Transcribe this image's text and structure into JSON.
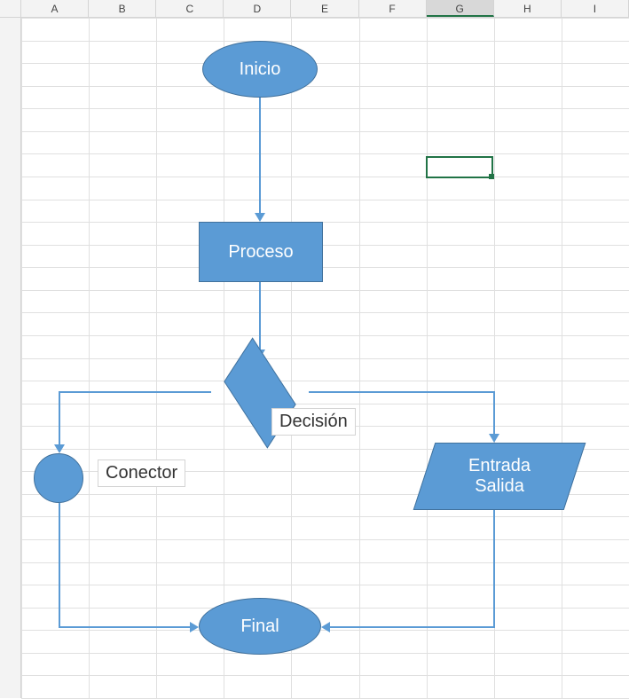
{
  "spreadsheet": {
    "columns": [
      "A",
      "B",
      "C",
      "D",
      "E",
      "F",
      "G",
      "H",
      "I"
    ],
    "selected_column_index": 6,
    "active_cell": {
      "col": "G",
      "row": 7
    }
  },
  "flowchart": {
    "shapes": {
      "start": {
        "type": "terminator",
        "label": "Inicio"
      },
      "process": {
        "type": "process",
        "label": "Proceso"
      },
      "decision": {
        "type": "decision",
        "label": "Decisión"
      },
      "io": {
        "type": "io",
        "label": "Entrada\nSalida"
      },
      "connector": {
        "type": "connector",
        "label": "Conector"
      },
      "end": {
        "type": "terminator",
        "label": "Final"
      }
    },
    "edges": [
      {
        "from": "start",
        "to": "process"
      },
      {
        "from": "process",
        "to": "decision"
      },
      {
        "from": "decision",
        "to": "connector",
        "branch": "left"
      },
      {
        "from": "decision",
        "to": "io",
        "branch": "right"
      },
      {
        "from": "connector",
        "to": "end"
      },
      {
        "from": "io",
        "to": "end"
      }
    ]
  }
}
